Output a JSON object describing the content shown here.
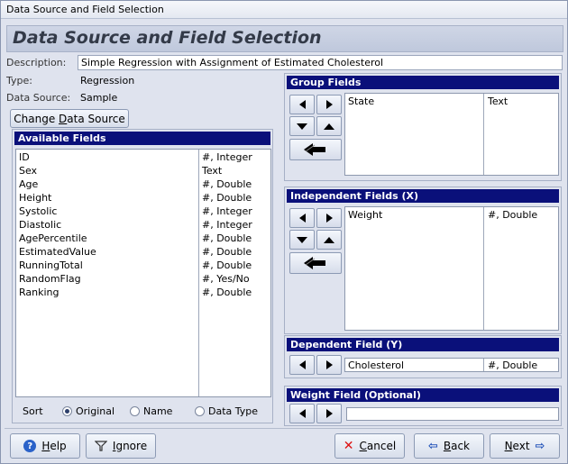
{
  "window": {
    "title": "Data Source and Field Selection"
  },
  "heading": "Data Source and Field Selection",
  "info": {
    "description_label": "Description:",
    "description_value": "Simple Regression with Assignment of Estimated Cholesterol",
    "type_label": "Type:",
    "type_value": "Regression",
    "datasource_label": "Data Source:",
    "datasource_value": "Sample"
  },
  "change_source": {
    "pre": "Change ",
    "accel": "D",
    "post": "ata Source"
  },
  "available": {
    "title": "Available Fields",
    "rows": [
      {
        "name": "ID",
        "type": "#, Integer"
      },
      {
        "name": "Sex",
        "type": "Text"
      },
      {
        "name": "Age",
        "type": "#, Double"
      },
      {
        "name": "Height",
        "type": "#, Double"
      },
      {
        "name": "Systolic",
        "type": "#, Integer"
      },
      {
        "name": "Diastolic",
        "type": "#, Integer"
      },
      {
        "name": "AgePercentile",
        "type": "#, Double"
      },
      {
        "name": "EstimatedValue",
        "type": "#, Double"
      },
      {
        "name": "RunningTotal",
        "type": "#, Double"
      },
      {
        "name": "RandomFlag",
        "type": "#, Yes/No"
      },
      {
        "name": "Ranking",
        "type": "#, Double"
      }
    ]
  },
  "sort": {
    "label": "Sort",
    "options": [
      "Original",
      "Name",
      "Data Type"
    ],
    "selected": "Original"
  },
  "group": {
    "title": "Group Fields",
    "rows": [
      {
        "name": "State",
        "type": "Text"
      }
    ]
  },
  "independent": {
    "title": "Independent Fields (X)",
    "rows": [
      {
        "name": "Weight",
        "type": "#, Double"
      }
    ]
  },
  "dependent": {
    "title": "Dependent Field (Y)",
    "name": "Cholesterol",
    "type": "#, Double"
  },
  "weight": {
    "title": "Weight Field (Optional)",
    "value": ""
  },
  "buttons": {
    "help": {
      "accel": "H",
      "rest": "elp"
    },
    "ignore": {
      "accel": "I",
      "rest": "gnore"
    },
    "cancel": {
      "accel": "C",
      "rest": "ancel"
    },
    "back": {
      "accel": "B",
      "rest": "ack"
    },
    "next": {
      "accel": "N",
      "rest": "ext"
    }
  }
}
